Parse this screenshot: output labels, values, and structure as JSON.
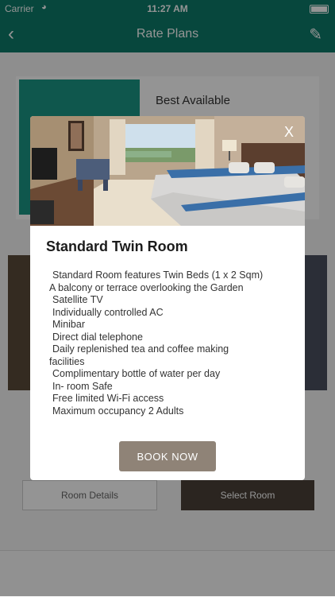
{
  "status_bar": {
    "carrier": "Carrier",
    "time": "11:27 AM"
  },
  "nav": {
    "title": "Rate Plans"
  },
  "background": {
    "hotel_name": "Best Available",
    "left_button": "Room Details",
    "right_button": "Select Room"
  },
  "modal": {
    "close_label": "X",
    "room_title": "Standard Twin Room",
    "features": [
      "Standard Room features Twin Beds (1 x 2 Sqm)",
      "A balcony or terrace overlooking the Garden",
      "Satellite TV",
      "Individually controlled AC",
      "Minibar",
      "Direct dial telephone",
      "Daily replenished tea and coffee making",
      "facilities",
      "Complimentary bottle of water per day",
      "In- room Safe",
      "Free limited Wi-Fi access",
      "Maximum occupancy 2 Adults"
    ],
    "book_button": "BOOK NOW"
  }
}
